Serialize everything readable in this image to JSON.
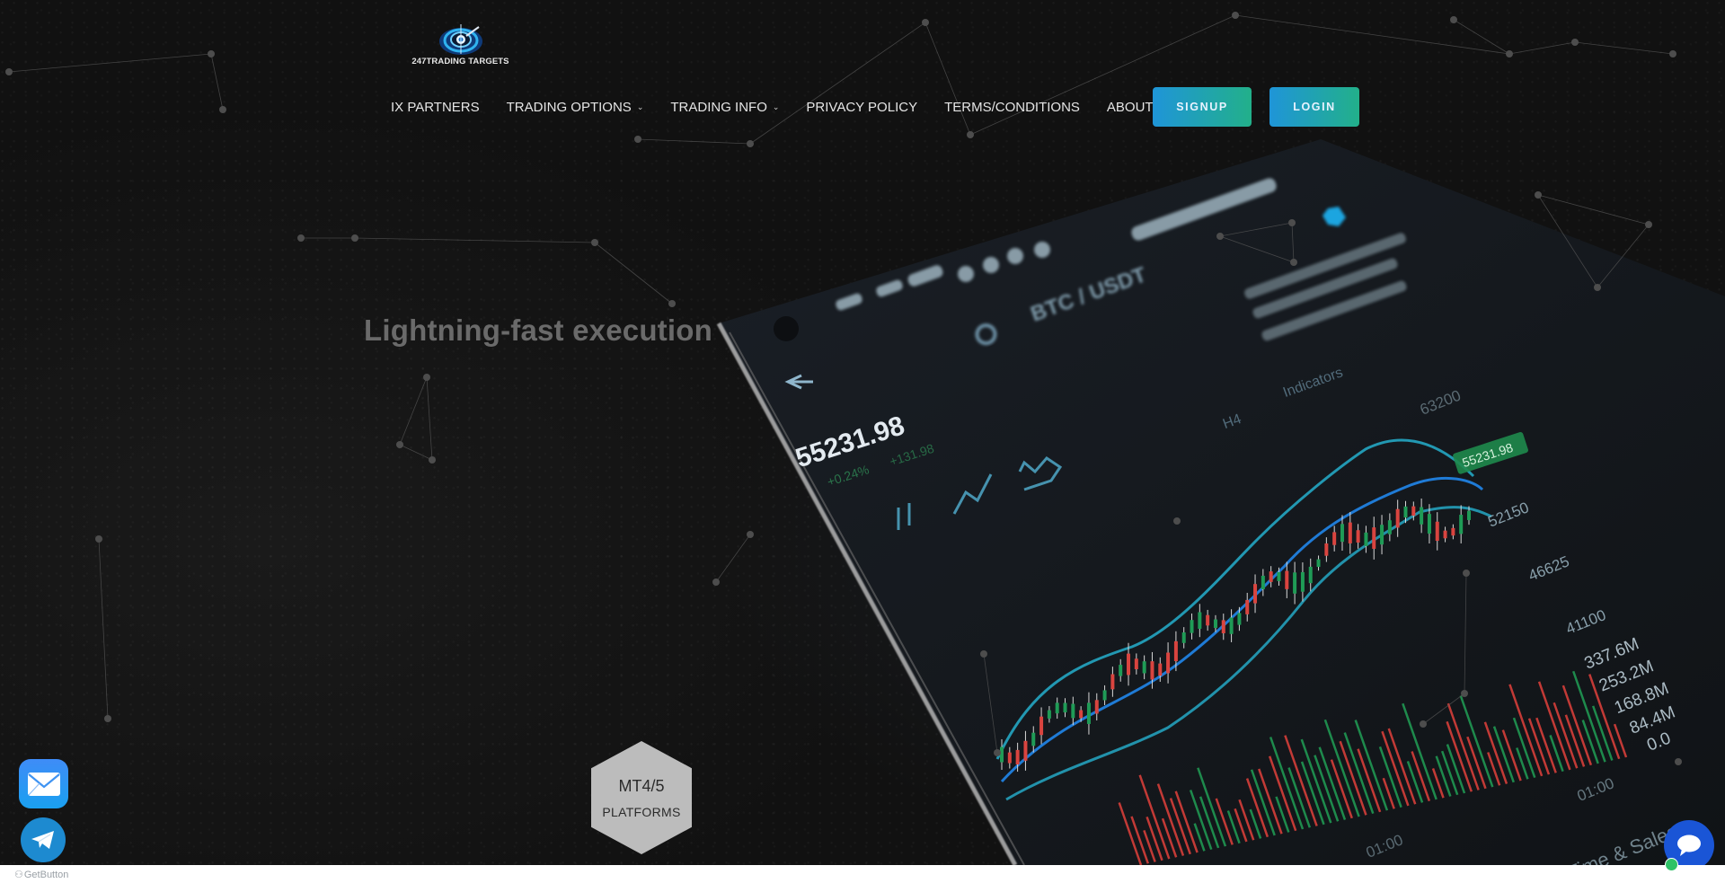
{
  "brand": {
    "name": "247TRADING TARGETS",
    "accent_gradient": [
      "#1f95d8",
      "#22b08a"
    ]
  },
  "nav": {
    "items": [
      {
        "label": "IX PARTNERS",
        "has_dropdown": false
      },
      {
        "label": "TRADING OPTIONS",
        "has_dropdown": true
      },
      {
        "label": "TRADING INFO",
        "has_dropdown": true
      },
      {
        "label": "PRIVACY POLICY",
        "has_dropdown": false
      },
      {
        "label": "TERMS/CONDITIONS",
        "has_dropdown": false
      },
      {
        "label": "ABOUT US",
        "has_dropdown": false
      }
    ],
    "chevron": "⌄",
    "signup_label": "SIGNUP",
    "login_label": "LOGIN"
  },
  "hero": {
    "headline": "Lightning-fast execution",
    "badge_title": "MT4/5",
    "badge_subtitle": "PLATFORMS",
    "background_phone": {
      "pair": "BTC / USDT",
      "price": "55231.98",
      "change": "+0.24%",
      "change_abs": "+131.98",
      "timeframe": "H4",
      "indicators_label": "Indicators",
      "price_tag": "55231.98",
      "price_axis": [
        "63200",
        "52150",
        "46625",
        "41100"
      ],
      "volume_axis": [
        "337.6M",
        "253.2M",
        "168.8M",
        "84.4M",
        "0.0"
      ],
      "time_labels": [
        "01:00",
        "01:00"
      ],
      "tab_label": "Time & Sales"
    }
  },
  "floating": {
    "mail_icon": "mail-icon",
    "telegram_icon": "telegram-icon",
    "chat_icon": "chat-bubble-icon",
    "getbutton_label": "GetButton",
    "online_color": "#2ec267"
  }
}
